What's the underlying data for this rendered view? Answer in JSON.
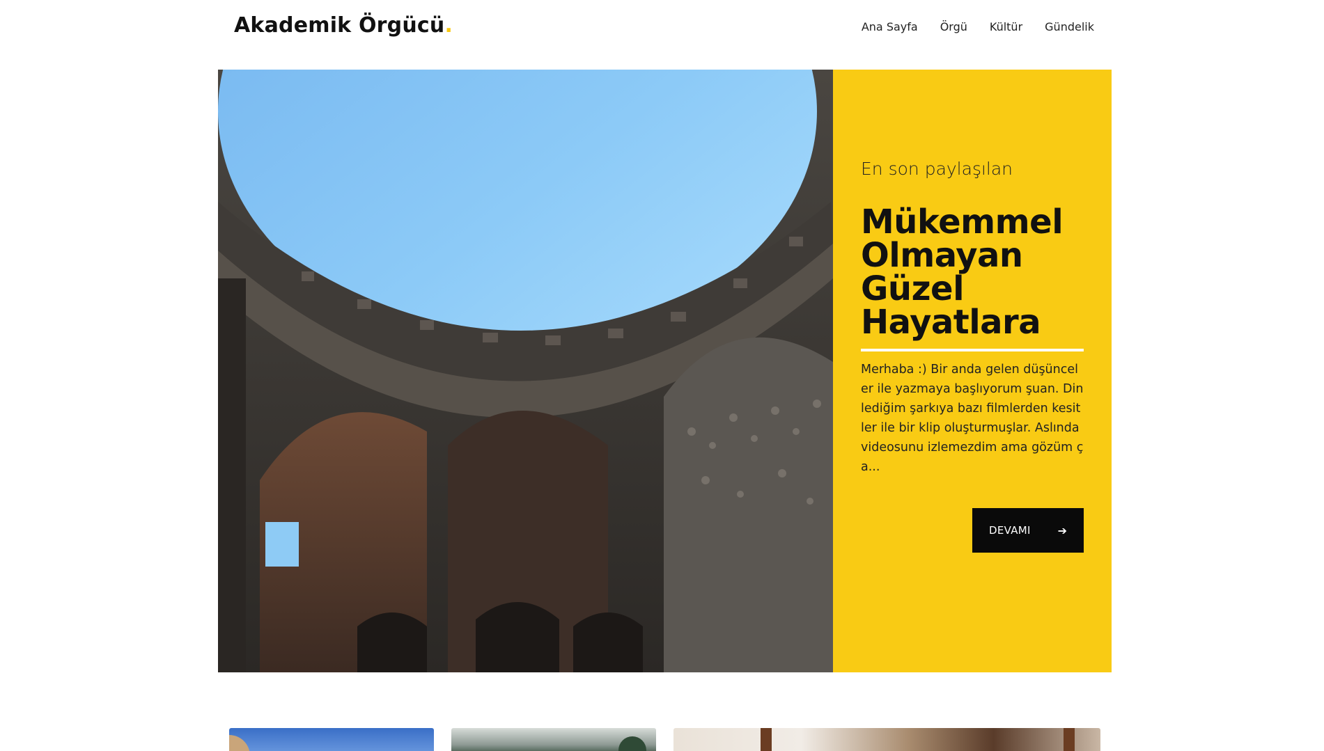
{
  "site": {
    "logo_text": "Akademik Örgücü",
    "logo_dot": ".",
    "accent_color": "#f9cb14"
  },
  "nav": {
    "items": [
      {
        "label": "Ana Sayfa"
      },
      {
        "label": "Örgü"
      },
      {
        "label": "Kültür"
      },
      {
        "label": "Gündelik"
      }
    ]
  },
  "hero": {
    "eyebrow": "En son paylaşılan",
    "title": "Mükemmel Olmayan Güzel Hayatlara",
    "excerpt": "Merhaba :) Bir anda gelen düşünceler ile yazmaya başlıyorum şuan. Dinlediğim şarkıya bazı filmlerden kesitler ile bir klip oluşturmuşlar. Aslında videosunu izlemezdim ama gözüm ça...",
    "button_label": "DEVAMI",
    "button_icon": "arrow-right-icon"
  },
  "cards": [
    {
      "name": "post-card-1"
    },
    {
      "name": "post-card-2"
    },
    {
      "name": "post-card-3"
    }
  ]
}
